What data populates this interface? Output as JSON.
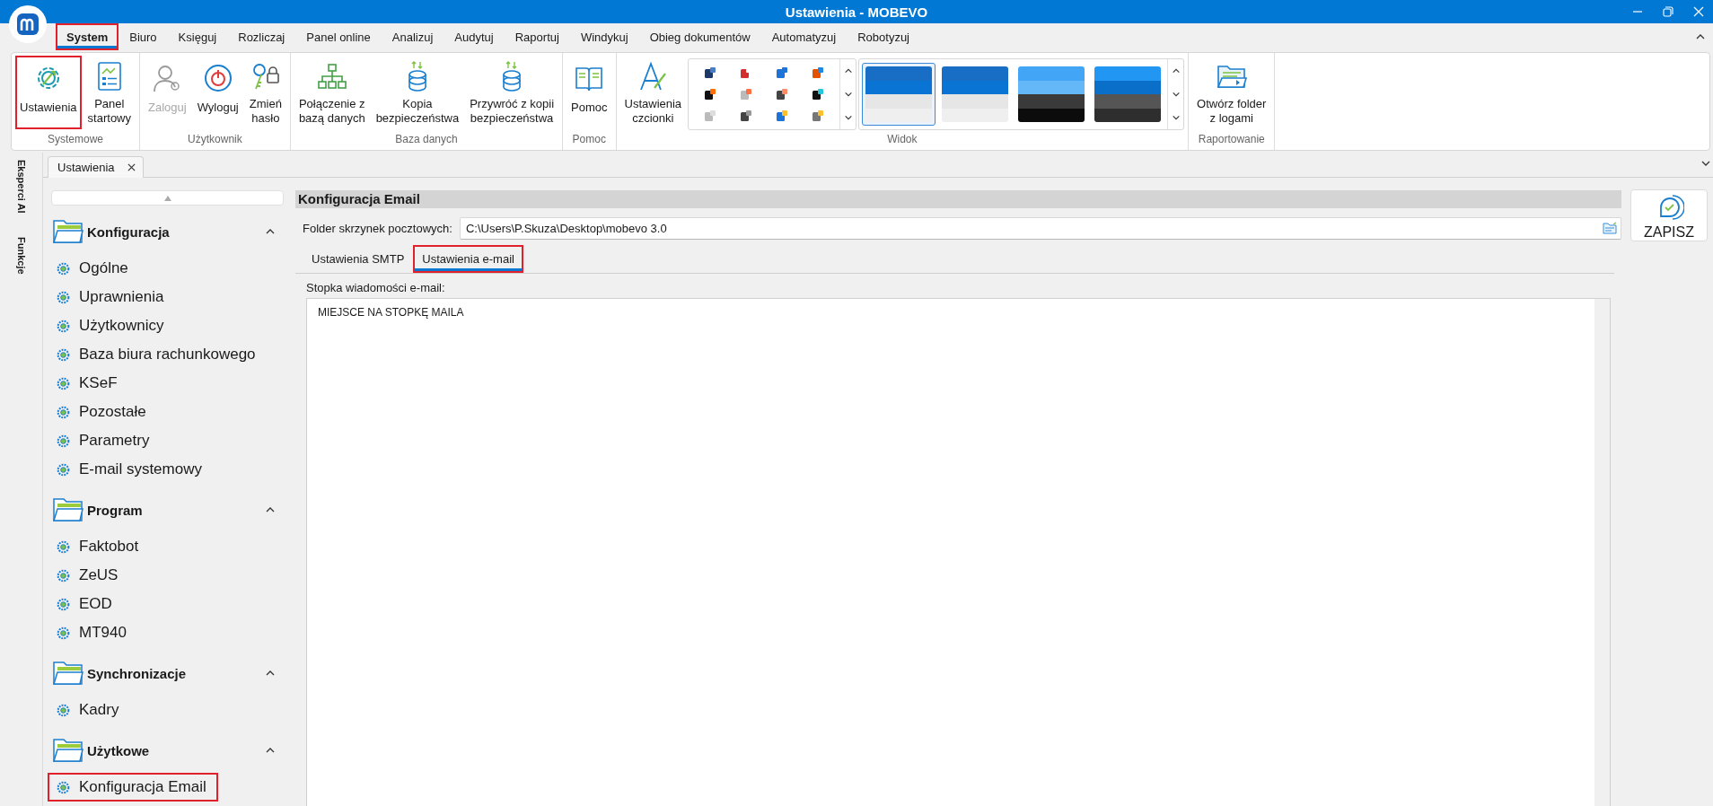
{
  "window": {
    "title": "Ustawienia - MOBEVO"
  },
  "menu_tabs": [
    {
      "label": "System",
      "selected": true,
      "highlighted": true
    },
    {
      "label": "Biuro",
      "selected": false,
      "highlighted": false
    },
    {
      "label": "Księguj",
      "selected": false,
      "highlighted": false
    },
    {
      "label": "Rozliczaj",
      "selected": false,
      "highlighted": false
    },
    {
      "label": "Panel online",
      "selected": false,
      "highlighted": false
    },
    {
      "label": "Analizuj",
      "selected": false,
      "highlighted": false
    },
    {
      "label": "Audytuj",
      "selected": false,
      "highlighted": false
    },
    {
      "label": "Raportuj",
      "selected": false,
      "highlighted": false
    },
    {
      "label": "Windykuj",
      "selected": false,
      "highlighted": false
    },
    {
      "label": "Obieg dokumentów",
      "selected": false,
      "highlighted": false
    },
    {
      "label": "Automatyzuj",
      "selected": false,
      "highlighted": false
    },
    {
      "label": "Robotyzuj",
      "selected": false,
      "highlighted": false
    }
  ],
  "ribbon": {
    "groups": [
      {
        "kind": "buttons",
        "caption": "Systemowe",
        "buttons": [
          {
            "lines": [
              "Ustawienia"
            ],
            "disabled": false,
            "highlighted": true
          },
          {
            "lines": [
              "Panel",
              "startowy"
            ],
            "disabled": false,
            "highlighted": false
          }
        ]
      },
      {
        "kind": "buttons",
        "caption": "Użytkownik",
        "buttons": [
          {
            "lines": [
              "Zaloguj"
            ],
            "disabled": true,
            "highlighted": false
          },
          {
            "lines": [
              "Wyloguj"
            ],
            "disabled": false,
            "highlighted": false
          },
          {
            "lines": [
              "Zmień",
              "hasło"
            ],
            "disabled": false,
            "highlighted": false
          }
        ]
      },
      {
        "kind": "buttons",
        "caption": "Baza danych",
        "buttons": [
          {
            "lines": [
              "Połączenie z",
              "bazą danych"
            ],
            "disabled": false,
            "highlighted": false
          },
          {
            "lines": [
              "Kopia",
              "bezpieczeństwa"
            ],
            "disabled": false,
            "highlighted": false
          },
          {
            "lines": [
              "Przywróć z kopii",
              "bezpieczeństwa"
            ],
            "disabled": false,
            "highlighted": false
          }
        ]
      },
      {
        "kind": "buttons",
        "caption": "Pomoc",
        "buttons": [
          {
            "lines": [
              "Pomoc"
            ],
            "disabled": false,
            "highlighted": false
          }
        ]
      },
      {
        "kind": "view",
        "caption": "Widok",
        "buttons": [
          {
            "lines": [
              "Ustawienia",
              "czcionki"
            ],
            "disabled": false,
            "highlighted": false
          }
        ],
        "themes": [
          {
            "selected": true
          },
          {
            "selected": false
          },
          {
            "selected": false
          },
          {
            "selected": false
          }
        ]
      },
      {
        "kind": "buttons",
        "caption": "Raportowanie",
        "buttons": [
          {
            "lines": [
              "Otwórz folder",
              "z logami"
            ],
            "disabled": false,
            "highlighted": false
          }
        ]
      }
    ]
  },
  "side_tabs": [
    {
      "label": "Eksperci AI"
    },
    {
      "label": "Funkcje"
    }
  ],
  "document_tabs": [
    {
      "label": "Ustawienia",
      "selected": true
    }
  ],
  "nav": {
    "groups": [
      {
        "title": "Konfiguracja",
        "expanded": true,
        "items": [
          {
            "label": "Ogólne",
            "highlighted": false
          },
          {
            "label": "Uprawnienia",
            "highlighted": false
          },
          {
            "label": "Użytkownicy",
            "highlighted": false
          },
          {
            "label": "Baza biura rachunkowego",
            "highlighted": false
          },
          {
            "label": "KSeF",
            "highlighted": false
          },
          {
            "label": "Pozostałe",
            "highlighted": false
          },
          {
            "label": "Parametry",
            "highlighted": false
          },
          {
            "label": "E-mail systemowy",
            "highlighted": false
          }
        ]
      },
      {
        "title": "Program",
        "expanded": true,
        "items": [
          {
            "label": "Faktobot",
            "highlighted": false
          },
          {
            "label": "ZeUS",
            "highlighted": false
          },
          {
            "label": "EOD",
            "highlighted": false
          },
          {
            "label": "MT940",
            "highlighted": false
          }
        ]
      },
      {
        "title": "Synchronizacje",
        "expanded": true,
        "items": [
          {
            "label": "Kadry",
            "highlighted": false
          }
        ]
      },
      {
        "title": "Użytkowe",
        "expanded": true,
        "items": [
          {
            "label": "Konfiguracja Email",
            "highlighted": true
          }
        ]
      }
    ]
  },
  "content": {
    "title": "Konfiguracja Email",
    "folder_field": {
      "label": "Folder skrzynek pocztowych:",
      "value": "C:\\Users\\P.Skuza\\Desktop\\mobevo 3.0"
    },
    "tabs": [
      {
        "label": "Ustawienia SMTP",
        "selected": false,
        "highlighted": false
      },
      {
        "label": "Ustawienia e-mail",
        "selected": true,
        "highlighted": true
      }
    ],
    "footer_label": "Stopka wiadomości e-mail:",
    "footer_value": "MIEJSCE NA STOPKĘ MAILA"
  },
  "save_button": {
    "label": "ZAPISZ"
  }
}
